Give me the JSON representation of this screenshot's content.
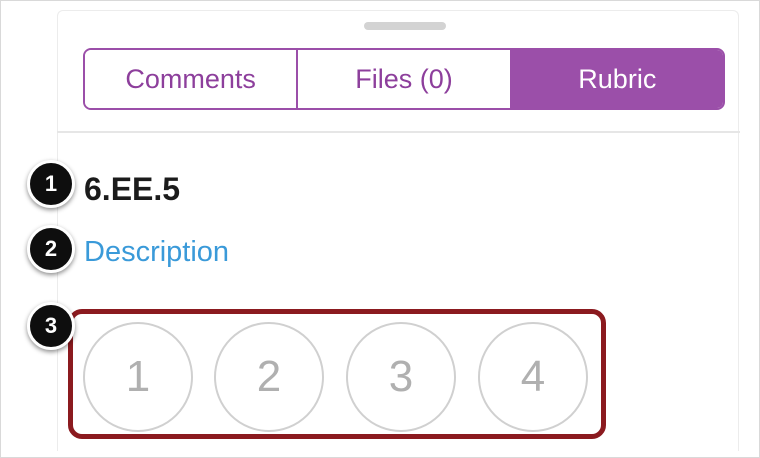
{
  "tabs": [
    {
      "label": "Comments",
      "active": false
    },
    {
      "label": "Files (0)",
      "active": false
    },
    {
      "label": "Rubric",
      "active": true
    }
  ],
  "criterion": {
    "title": "6.EE.5",
    "description_link": "Description"
  },
  "ratings": [
    "1",
    "2",
    "3",
    "4"
  ],
  "callouts": [
    "1",
    "2",
    "3"
  ],
  "colors": {
    "accent": "#9b4fa9",
    "link": "#3a9ad9",
    "highlight_box": "#8b1a1f"
  }
}
